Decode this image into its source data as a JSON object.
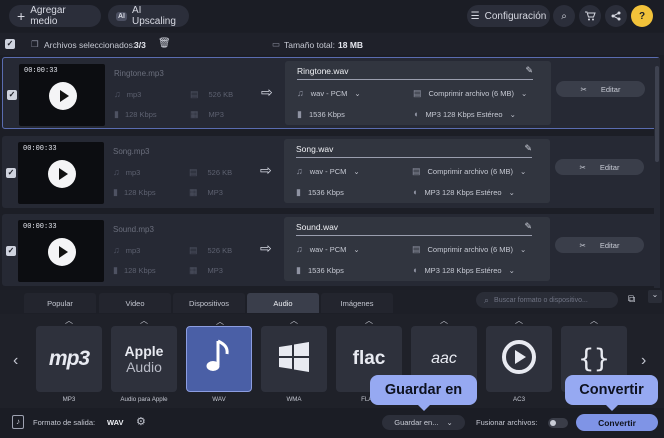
{
  "toolbar": {
    "add_media": "Agregar medio",
    "ai_upscaling": "AI Upscaling",
    "ai_badge": "AI",
    "settings": "Configuración"
  },
  "selection": {
    "files_selected_label": "Archivos seleccionados:",
    "files_selected_value": "3/3",
    "total_size_label": "Tamaño total:",
    "total_size_value": "18 MB"
  },
  "files": [
    {
      "duration": "00:00:33",
      "source_name": "Ringtone.mp3",
      "codec": "mp3",
      "size": "526 KB",
      "bitrate": "128 Kbps",
      "format": "MP3",
      "output_name": "Ringtone.wav",
      "out_codec": "wav - PCM",
      "compress": "Comprimir archivo (6 MB)",
      "out_bitrate": "1536 Kbps",
      "audio": "MP3 128 Kbps Estéreo",
      "edit": "Editar"
    },
    {
      "duration": "00:00:33",
      "source_name": "Song.mp3",
      "codec": "mp3",
      "size": "526 KB",
      "bitrate": "128 Kbps",
      "format": "MP3",
      "output_name": "Song.wav",
      "out_codec": "wav - PCM",
      "compress": "Comprimir archivo (6 MB)",
      "out_bitrate": "1536 Kbps",
      "audio": "MP3 128 Kbps Estéreo",
      "edit": "Editar"
    },
    {
      "duration": "00:00:33",
      "source_name": "Sound.mp3",
      "codec": "mp3",
      "size": "526 KB",
      "bitrate": "128 Kbps",
      "format": "MP3",
      "output_name": "Sound.wav",
      "out_codec": "wav - PCM",
      "compress": "Comprimir archivo (6 MB)",
      "out_bitrate": "1536 Kbps",
      "audio": "MP3 128 Kbps Estéreo",
      "edit": "Editar"
    }
  ],
  "tabs": [
    "Popular",
    "Video",
    "Dispositivos",
    "Audio",
    "Imágenes"
  ],
  "active_tab": "Audio",
  "search_placeholder": "Buscar formato o dispositivo...",
  "formats": [
    {
      "label": "MP3",
      "icon": "mp3"
    },
    {
      "label": "Audio para Apple",
      "icon": "Apple Audio",
      "line1": "Apple",
      "line2": "Audio"
    },
    {
      "label": "WAV",
      "icon": "music-note-icon"
    },
    {
      "label": "WMA",
      "icon": "windows-icon"
    },
    {
      "label": "FLAC",
      "icon": "flac"
    },
    {
      "label": "",
      "icon": "aac"
    },
    {
      "label": "AC3",
      "icon": "play-circle-icon"
    },
    {
      "label": "",
      "icon": "braces-icon"
    }
  ],
  "bottom": {
    "output_format_label": "Formato de salida:",
    "output_format_value": "WAV",
    "save_to": "Guardar en...",
    "merge_files": "Fusionar archivos:",
    "convert": "Convertir"
  },
  "tooltips": {
    "save_to": "Guardar en",
    "convert": "Convertir"
  },
  "colors": {
    "accent": "#7f94e6",
    "tooltip": "#96a9f2",
    "help": "#f2c23a",
    "background": "#1c1e26"
  }
}
